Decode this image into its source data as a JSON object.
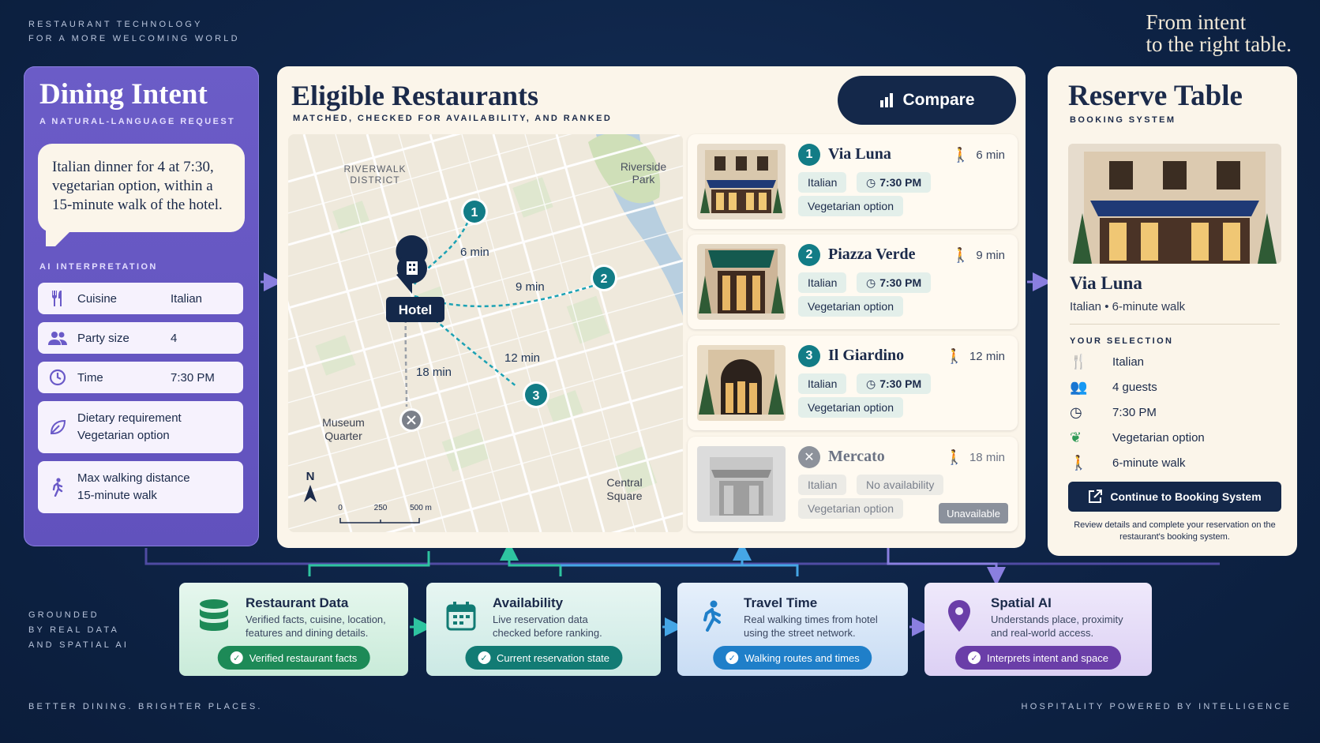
{
  "header": {
    "eyebrow_line1": "RESTAURANT TECHNOLOGY",
    "eyebrow_line2": "FOR A MORE WELCOMING WORLD",
    "tagline_line1": "From intent",
    "tagline_line2": "to the right table."
  },
  "intent": {
    "title": "Dining Intent",
    "subtitle": "A NATURAL-LANGUAGE REQUEST",
    "request": "Italian dinner for 4 at 7:30, vegetarian option, within a 15-minute walk of the hotel.",
    "ai_label": "AI INTERPRETATION",
    "fields": [
      {
        "key": "Cuisine",
        "value": "Italian",
        "icon": "fork-knife-icon"
      },
      {
        "key": "Party size",
        "value": "4",
        "icon": "people-icon"
      },
      {
        "key": "Time",
        "value": "7:30 PM",
        "icon": "clock-icon"
      },
      {
        "key": "Dietary requirement",
        "value": "Vegetarian option",
        "icon": "leaf-icon"
      },
      {
        "key": "Max walking distance",
        "value": "15-minute walk",
        "icon": "walker-icon"
      }
    ]
  },
  "eligible": {
    "title": "Eligible Restaurants",
    "subtitle": "MATCHED, CHECKED FOR AVAILABILITY, AND RANKED",
    "compare_label": "Compare",
    "map": {
      "district": "RIVERWALK\nDISTRICT",
      "park": "Riverside\nPark",
      "museum": "Museum\nQuarter",
      "square": "Central\nSquare",
      "hotel": "Hotel",
      "routes": [
        "6 min",
        "9 min",
        "12 min",
        "18 min"
      ],
      "markers": [
        "1",
        "2",
        "3"
      ],
      "north": "N",
      "scale": [
        "0",
        "250",
        "500 m"
      ]
    },
    "restaurants": [
      {
        "rank": "1",
        "name": "Via Luna",
        "walk": "6 min",
        "cuisine": "Italian",
        "time": "7:30 PM",
        "diet": "Vegetarian option"
      },
      {
        "rank": "2",
        "name": "Piazza Verde",
        "walk": "9 min",
        "cuisine": "Italian",
        "time": "7:30 PM",
        "diet": "Vegetarian option"
      },
      {
        "rank": "3",
        "name": "Il Giardino",
        "walk": "12 min",
        "cuisine": "Italian",
        "time": "7:30 PM",
        "diet": "Vegetarian option"
      },
      {
        "rank": "",
        "name": "Mercato",
        "walk": "18 min",
        "cuisine": "Italian",
        "time": "No availability",
        "diet": "Vegetarian option",
        "status": "Unavailable"
      }
    ]
  },
  "reserve": {
    "title": "Reserve Table",
    "subtitle": "BOOKING SYSTEM",
    "name": "Via Luna",
    "meta": "Italian  •  6-minute walk",
    "selection_label": "YOUR SELECTION",
    "selection": [
      "Italian",
      "4 guests",
      "7:30 PM",
      "Vegetarian option",
      "6-minute walk"
    ],
    "button": "Continue to Booking System",
    "note": "Review details and complete your reservation on the restaurant's booking system."
  },
  "grounded": {
    "line1": "GROUNDED",
    "line2": "BY REAL DATA",
    "line3": "AND SPATIAL AI"
  },
  "sources": [
    {
      "title": "Restaurant Data",
      "desc": "Verified facts, cuisine, location, features and dining details.",
      "chip": "Verified restaurant facts",
      "color": "#1d8a57"
    },
    {
      "title": "Availability",
      "desc": "Live reservation data checked before ranking.",
      "chip": "Current reservation state",
      "color": "#127b74"
    },
    {
      "title": "Travel Time",
      "desc": "Real walking times from hotel using the street network.",
      "chip": "Walking routes and times",
      "color": "#1f7fc9"
    },
    {
      "title": "Spatial AI",
      "desc": "Understands place, proximity and real-world access.",
      "chip": "Interprets intent and space",
      "color": "#6a3ea8"
    }
  ],
  "footer": {
    "left": "BETTER DINING. BRIGHTER PLACES.",
    "right": "HOSPITALITY POWERED BY INTELLIGENCE"
  }
}
